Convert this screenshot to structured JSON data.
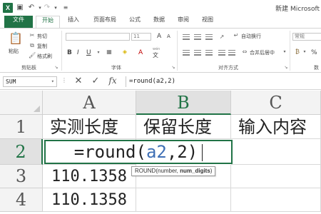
{
  "titlebar": {
    "app_icon": "excel-icon",
    "title": "新建 Microsoft",
    "quick_access": [
      "save-icon",
      "undo-icon",
      "redo-icon",
      "customize-icon"
    ]
  },
  "tabs": [
    {
      "label": "文件",
      "kind": "file"
    },
    {
      "label": "开始",
      "kind": "active"
    },
    {
      "label": "插入"
    },
    {
      "label": "页面布局"
    },
    {
      "label": "公式"
    },
    {
      "label": "数据"
    },
    {
      "label": "审阅"
    },
    {
      "label": "视图"
    }
  ],
  "ribbon": {
    "clipboard": {
      "paste_label": "粘贴",
      "cut_label": "剪切",
      "copy_label": "复制",
      "format_painter_label": "格式刷",
      "group_label": "剪贴板"
    },
    "font": {
      "font_size": "11",
      "group_label": "字体",
      "bold": "B",
      "italic": "I",
      "underline": "U",
      "grow": "A",
      "shrink": "A",
      "font_color": "A",
      "wen": "wén",
      "wen_char": "文"
    },
    "alignment": {
      "wrap_label": "自动换行",
      "merge_label": "合并后居中",
      "group_label": "对齐方式"
    },
    "number": {
      "format_label": "常规",
      "percent": "%",
      "group_label": "数"
    }
  },
  "formula_bar": {
    "name_box": "SUM",
    "cancel": "✕",
    "enter": "✓",
    "fx": "fx",
    "formula": "=round(a2,2)"
  },
  "sheet": {
    "columns": [
      "A",
      "B",
      "C"
    ],
    "selected_column": "B",
    "rows": [
      {
        "num": "1",
        "cells": [
          "实测长度",
          "保留长度",
          "输入内容"
        ]
      },
      {
        "num": "2",
        "cells": [
          "",
          "",
          ""
        ]
      },
      {
        "num": "3",
        "cells": [
          "110.1358",
          "",
          ""
        ]
      },
      {
        "num": "4",
        "cells": [
          "110.1358",
          "",
          ""
        ]
      }
    ],
    "selected_row": "2",
    "edit_formula_prefix": "=round(",
    "edit_formula_ref": "a2",
    "edit_formula_suffix": ",2)",
    "tooltip_fn": "ROUND(number, ",
    "tooltip_arg": "num_digits",
    "tooltip_end": ")"
  },
  "colors": {
    "accent": "#217346",
    "ref_blue": "#3e6fb5"
  }
}
